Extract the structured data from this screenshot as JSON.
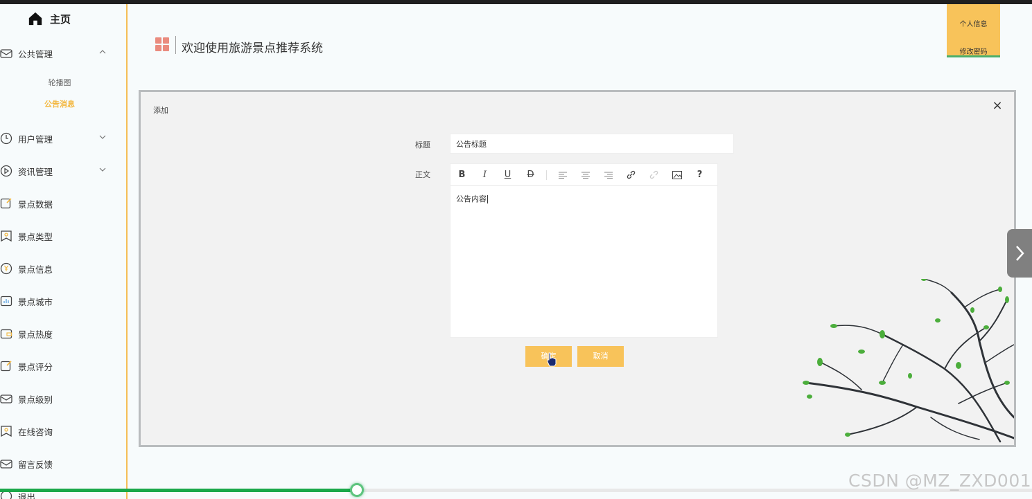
{
  "sidebar": {
    "home": "主页",
    "items": [
      {
        "label": "公共管理",
        "icon": "envelope-icon",
        "expanded": true
      },
      {
        "label": "用户管理",
        "icon": "clock-icon",
        "expanded": false
      },
      {
        "label": "资讯管理",
        "icon": "play-circle-icon",
        "expanded": false
      },
      {
        "label": "景点数据",
        "icon": "edit-icon"
      },
      {
        "label": "景点类型",
        "icon": "badge-icon"
      },
      {
        "label": "景点信息",
        "icon": "yen-circle-icon"
      },
      {
        "label": "景点城市",
        "icon": "chart-icon"
      },
      {
        "label": "景点热度",
        "icon": "wallet-icon"
      },
      {
        "label": "景点评分",
        "icon": "edit-icon"
      },
      {
        "label": "景点级别",
        "icon": "envelope-icon"
      },
      {
        "label": "在线咨询",
        "icon": "badge-icon"
      },
      {
        "label": "留言反馈",
        "icon": "envelope-icon"
      },
      {
        "label": "退出",
        "icon": "power-icon"
      }
    ],
    "sub_items": [
      "轮播图",
      "公告消息"
    ],
    "active_sub": "公告消息"
  },
  "header": {
    "title": "欢迎使用旅游景点推荐系统",
    "user_menu": {
      "profile": "个人信息",
      "change_password": "修改密码"
    }
  },
  "dialog": {
    "title": "添加",
    "title_label": "标题",
    "title_value": "公告标题",
    "body_label": "正文",
    "body_value": "公告内容",
    "confirm": "确定",
    "cancel": "取消"
  },
  "watermark": "CSDN @MZ_ZXD001",
  "playback": {
    "progress": 0.346
  },
  "colors": {
    "accent": "#f8c35a",
    "active_text": "#f3b73e",
    "progress": "#1aa84a",
    "logo": "#ea8b7e"
  }
}
